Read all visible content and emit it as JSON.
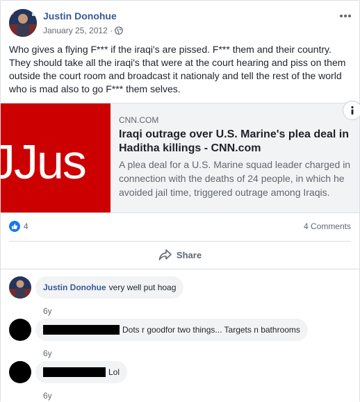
{
  "post": {
    "author": "Justin Donohue",
    "date": "January 25, 2012 ·",
    "privacy_icon": "globe-icon",
    "text": "Who gives a flying F*** if the iraqi's are pissed. F*** them and their country. They should take all the iraqi's that were at the court hearing and piss on them outside the court room and broadcast it nationaly and tell the rest of the world who is mad also to go F*** them selves."
  },
  "link_preview": {
    "image_text": "JJus",
    "domain": "CNN.COM",
    "title": "Iraqi outrage over U.S. Marine's plea deal in Haditha killings - CNN.com",
    "description": "A plea deal for a U.S. Marine squad leader charged in connection with the deaths of 24 people, in which he avoided jail time, triggered outrage among Iraqis."
  },
  "stats": {
    "like_count": "4",
    "comments_count": "4 Comments"
  },
  "actions": {
    "share_label": "Share"
  },
  "comments": [
    {
      "name": "Justin Donohue",
      "text": "very well put hoag",
      "time": "6y"
    },
    {
      "name": "",
      "text": "Dots r goodfor two things... Targets n bathrooms",
      "time": "6y"
    },
    {
      "name": "",
      "text": "Lol",
      "time": "6y"
    }
  ],
  "colors": {
    "link_blue": "#385898",
    "like_blue": "#1877f2",
    "cnn_red": "#cc0000"
  }
}
